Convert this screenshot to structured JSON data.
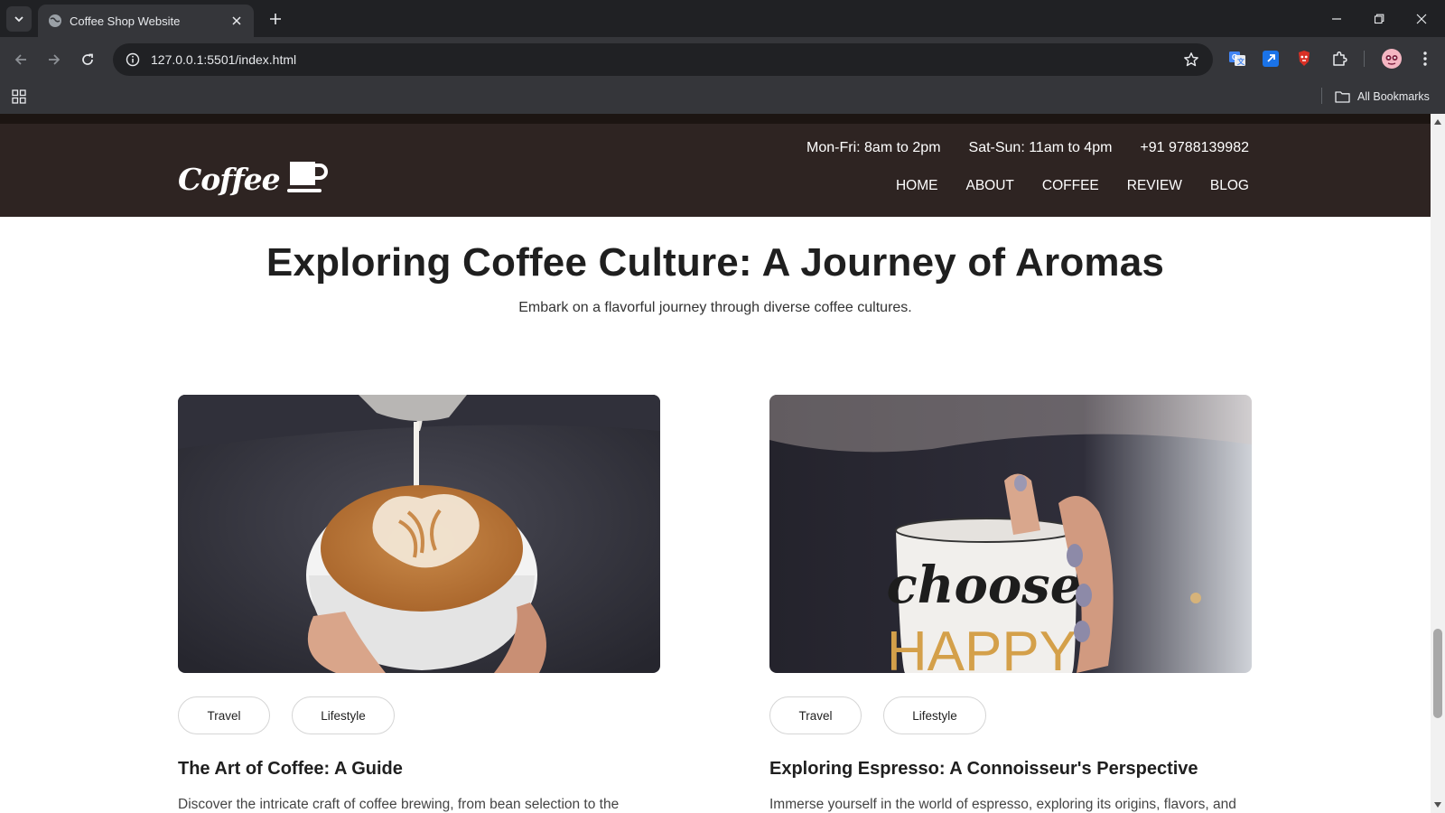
{
  "browser": {
    "tab_title": "Coffee Shop Website",
    "url": "127.0.0.1:5501/index.html",
    "bookmarks_label": "All Bookmarks"
  },
  "site": {
    "logo_text": "Coffee",
    "info": {
      "weekday_hours": "Mon-Fri: 8am to 2pm",
      "weekend_hours": "Sat-Sun: 11am to 4pm",
      "phone": "+91 9788139982"
    },
    "nav": [
      "HOME",
      "ABOUT",
      "COFFEE",
      "REVIEW",
      "BLOG"
    ]
  },
  "hero": {
    "title": "Exploring Coffee Culture: A Journey of Aromas",
    "subtitle": "Embark on a flavorful journey through diverse coffee cultures."
  },
  "posts": [
    {
      "tags": [
        "Travel",
        "Lifestyle"
      ],
      "title": "The Art of Coffee: A Guide",
      "desc": "Discover the intricate craft of coffee brewing, from bean selection to the"
    },
    {
      "tags": [
        "Travel",
        "Lifestyle"
      ],
      "title": "Exploring Espresso: A Connoisseur's Perspective",
      "desc": "Immerse yourself in the world of espresso, exploring its origins, flavors, and",
      "mug_text": [
        "choose",
        "HAPPY"
      ]
    }
  ]
}
